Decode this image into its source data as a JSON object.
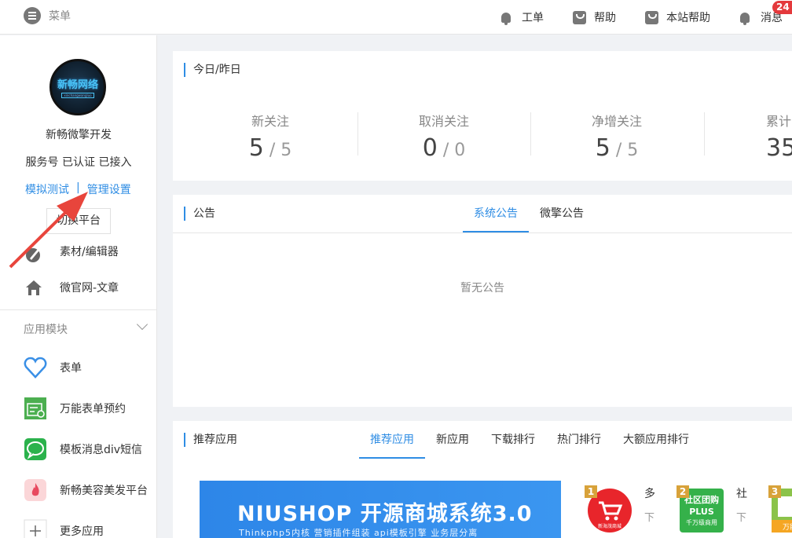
{
  "topbar": {
    "menu_label": "菜单",
    "nav": [
      {
        "label": "工单",
        "icon": "bell-icon"
      },
      {
        "label": "帮助",
        "icon": "bag-icon"
      },
      {
        "label": "本站帮助",
        "icon": "bag-icon"
      },
      {
        "label": "消息",
        "icon": "bell-icon"
      }
    ],
    "message_badge": "24"
  },
  "sidebar": {
    "avatar_text": "新畅网络",
    "avatar_sub": "xinchangwangluo",
    "account_name": "新畅微擎开发",
    "account_status": "服务号 已认证 已接入",
    "link_test": "模拟测试",
    "link_sep": "|",
    "link_manage": "管理设置",
    "switch_label": "切换平台",
    "items": [
      {
        "label": "素材/编辑器",
        "icon": "pen-icon"
      },
      {
        "label": "微官网-文章",
        "icon": "home-icon"
      }
    ],
    "group_title": "应用模块",
    "apps": [
      {
        "label": "表单",
        "icon": "heart-icon"
      },
      {
        "label": "万能表单预约",
        "icon": "form-booking-icon"
      },
      {
        "label": "模板消息div短信",
        "icon": "chat-icon"
      },
      {
        "label": "新畅美容美发平台",
        "icon": "flame-icon"
      },
      {
        "label": "更多应用",
        "icon": "plus-icon"
      }
    ]
  },
  "stats": {
    "title": "今日/昨日",
    "items": [
      {
        "label": "新关注",
        "today": "5",
        "yesterday": "5"
      },
      {
        "label": "取消关注",
        "today": "0",
        "yesterday": "0"
      },
      {
        "label": "净增关注",
        "today": "5",
        "yesterday": "5"
      },
      {
        "label": "累计",
        "today": "35",
        "yesterday": ""
      }
    ],
    "slash": "/"
  },
  "notice": {
    "title": "公告",
    "tabs": [
      "系统公告",
      "微擎公告"
    ],
    "empty_text": "暂无公告"
  },
  "recommend": {
    "title": "推荐应用",
    "tabs": [
      "推荐应用",
      "新应用",
      "下载排行",
      "热门排行",
      "大额应用排行"
    ],
    "banner_title": "NIUSHOP 开源商城系统3.0",
    "banner_sub": "Thinkphp5内核   营销插件组装   api模板引擎   业务层分离",
    "apps": [
      {
        "rank": "1",
        "title": "多",
        "desc": "下",
        "logo_text": "新海茂商城"
      },
      {
        "rank": "2",
        "title": "社",
        "desc": "下",
        "logo_text": "社区团购",
        "logo_sub": "PLUS",
        "logo_sub2": "千万级商用"
      },
      {
        "rank": "3",
        "logo_text": "万能"
      }
    ]
  },
  "colors": {
    "accent": "#2f8de4",
    "badge": "#e4393c",
    "annotation_arrow": "#e8453c"
  }
}
